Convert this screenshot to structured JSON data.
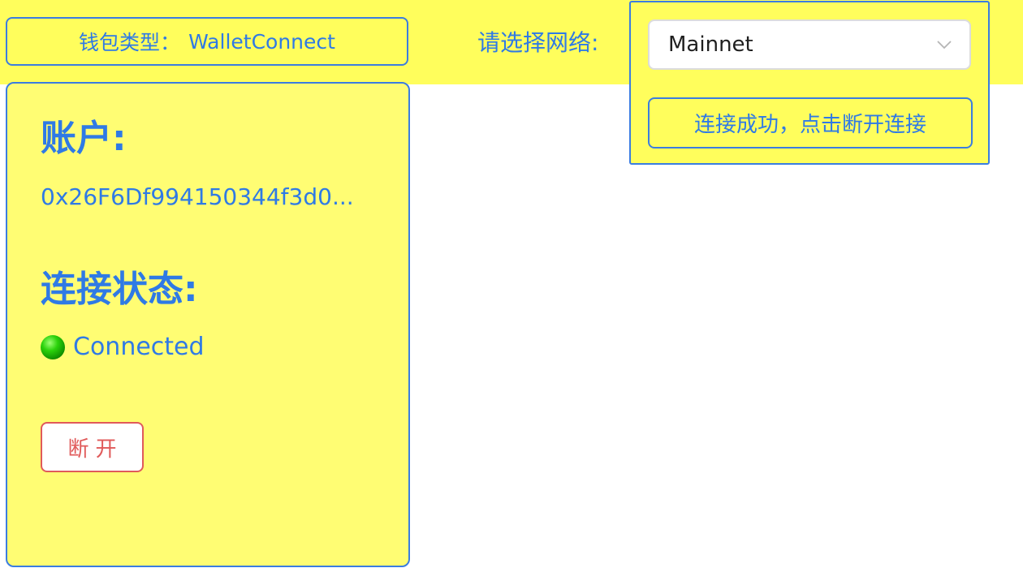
{
  "header": {
    "wallet_type_label": "钱包类型：",
    "wallet_type_value": "WalletConnect",
    "network_label": "请选择网络:"
  },
  "network_panel": {
    "selected_network": "Mainnet",
    "status_button_label": "连接成功，点击断开连接"
  },
  "account_card": {
    "account_heading": "账户:",
    "address": "0x26F6Df994150344f3d0...",
    "status_heading": "连接状态:",
    "status_text": "Connected",
    "status_color": "#12a800",
    "disconnect_label": "断开"
  },
  "colors": {
    "accent": "#2f7ae5",
    "background_yellow": "#fffe5c",
    "card_yellow": "#fffd73",
    "danger": "#e05a5a"
  }
}
